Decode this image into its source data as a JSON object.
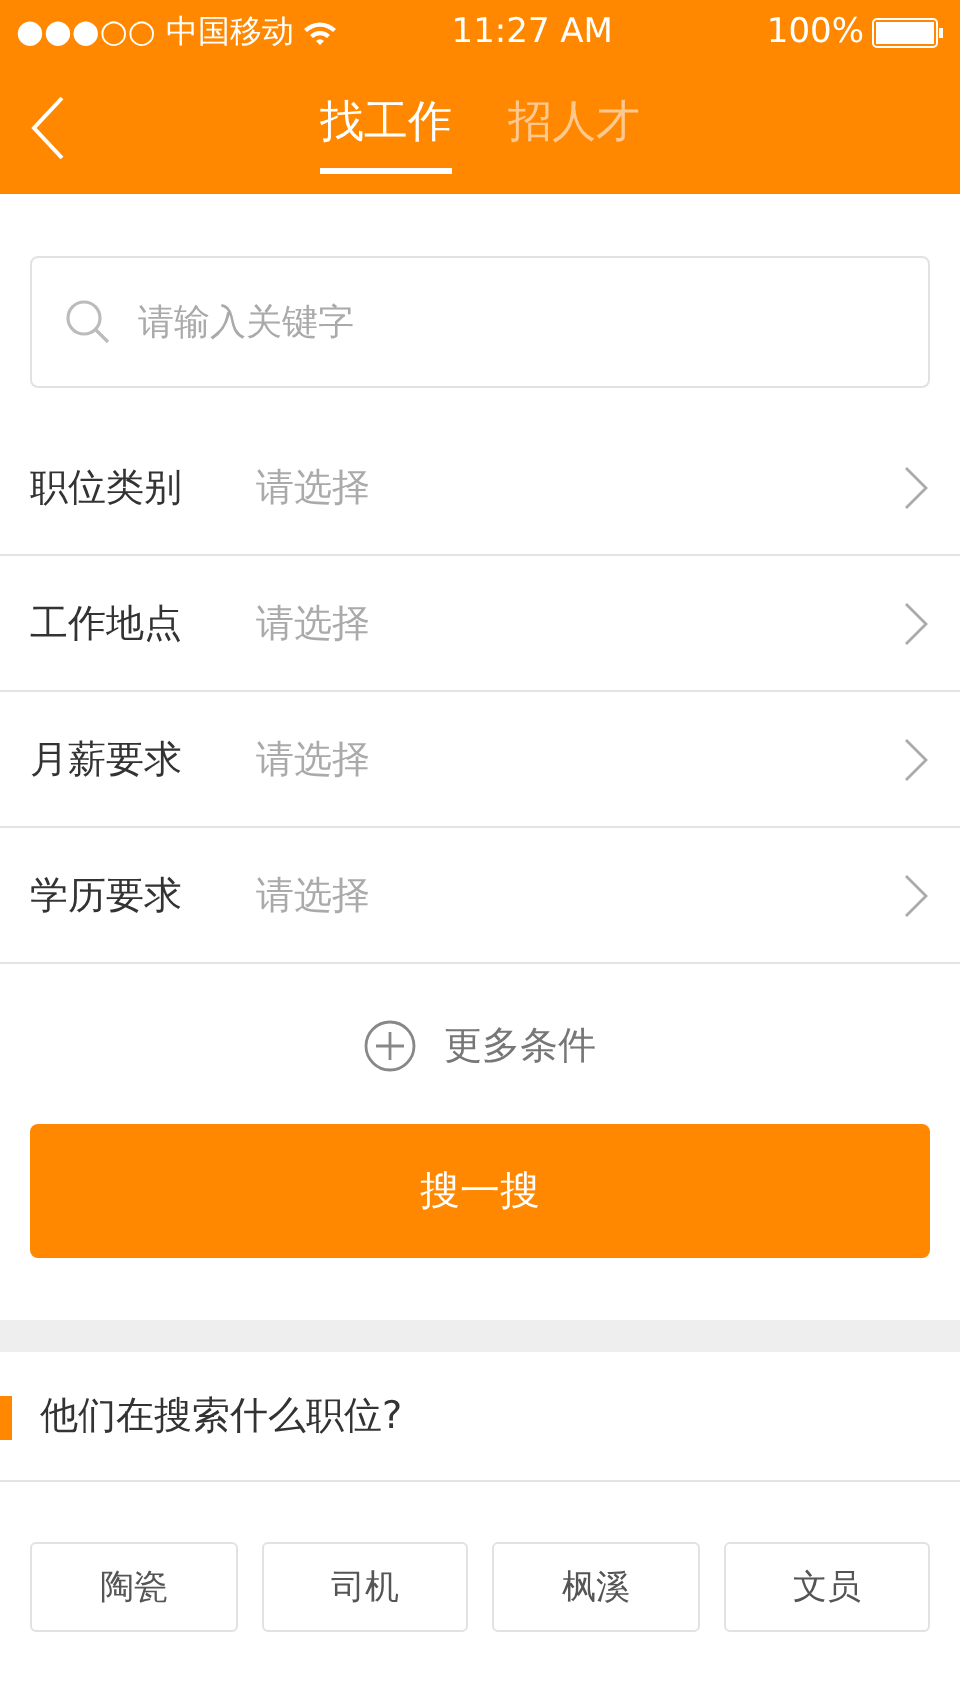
{
  "status_bar": {
    "carrier": "●●●○○ 中国移动",
    "time": "11:27 AM",
    "battery": "100%"
  },
  "tabs": [
    {
      "label": "找工作",
      "selected": true
    },
    {
      "label": "招人才",
      "selected": false
    }
  ],
  "search": {
    "placeholder": "请输入关键字"
  },
  "filters": [
    {
      "label": "职位类别",
      "placeholder": "请选择"
    },
    {
      "label": "工作地点",
      "placeholder": "请选择"
    },
    {
      "label": "月薪要求",
      "placeholder": "请选择"
    },
    {
      "label": "学历要求",
      "placeholder": "请选择"
    }
  ],
  "more_conditions": "更多条件",
  "search_button": "搜一搜",
  "section_title": "他们在搜索什么职位?",
  "tags": [
    "陶瓷",
    "司机",
    "枫溪",
    "文员"
  ]
}
